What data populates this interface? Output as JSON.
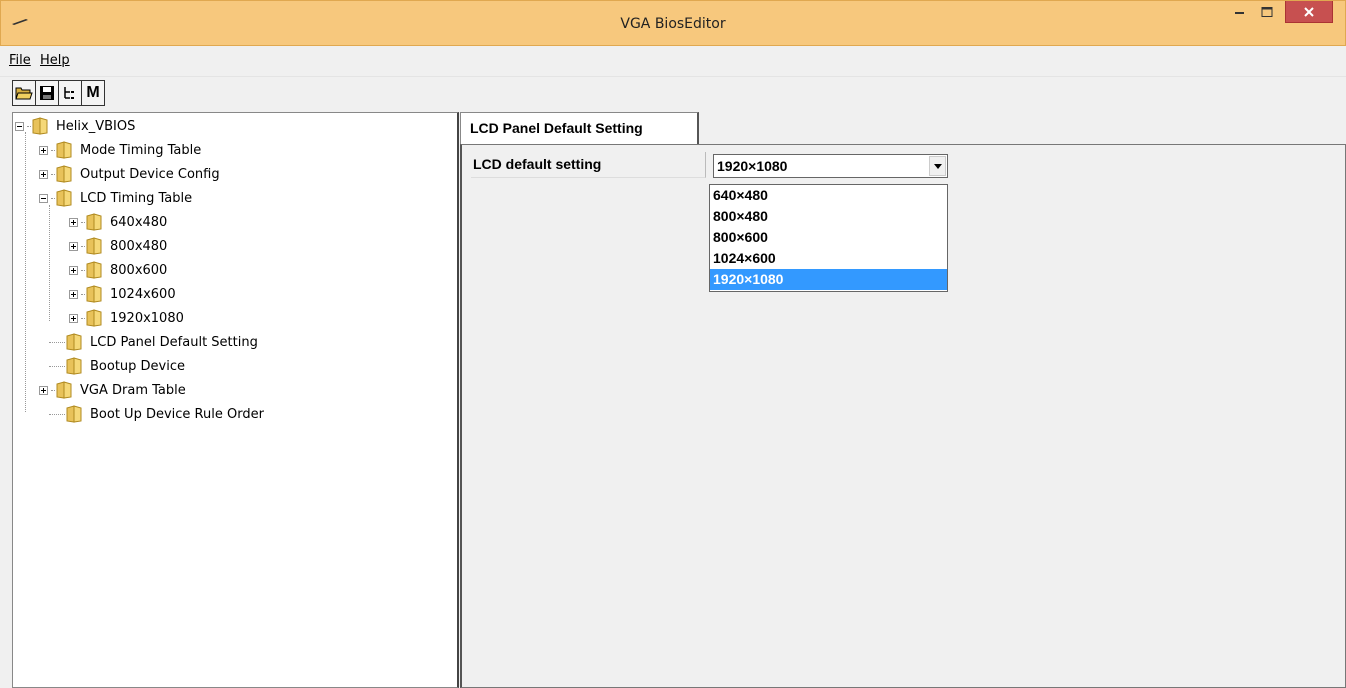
{
  "window": {
    "title": "VGA BiosEditor"
  },
  "menu": {
    "file": "File",
    "help": "Help"
  },
  "toolbar": {
    "m_label": "M"
  },
  "tree": {
    "root": "Helix_VBIOS",
    "items": [
      {
        "label": "Mode Timing Table",
        "expander": "plus"
      },
      {
        "label": "Output Device Config",
        "expander": "plus"
      },
      {
        "label": "LCD Timing Table",
        "expander": "minus"
      },
      {
        "label": "640x480",
        "expander": "plus"
      },
      {
        "label": "800x480",
        "expander": "plus"
      },
      {
        "label": "800x600",
        "expander": "plus"
      },
      {
        "label": "1024x600",
        "expander": "plus"
      },
      {
        "label": "1920x1080",
        "expander": "plus"
      },
      {
        "label": "LCD Panel Default Setting",
        "expander": "none"
      },
      {
        "label": "Bootup Device",
        "expander": "none"
      },
      {
        "label": "VGA Dram Table",
        "expander": "plus"
      },
      {
        "label": "Boot Up Device Rule Order",
        "expander": "none"
      }
    ]
  },
  "panel": {
    "tab_label": "LCD Panel Default Setting",
    "property_label": "LCD default setting",
    "selected_value": "1920×1080",
    "options": [
      "640×480",
      "800×480",
      "800×600",
      "1024×600",
      "1920×1080"
    ],
    "highlighted_index": 4
  },
  "colors": {
    "titlebar": "#f7c87d",
    "close_button": "#c75050",
    "selection": "#3399ff"
  }
}
